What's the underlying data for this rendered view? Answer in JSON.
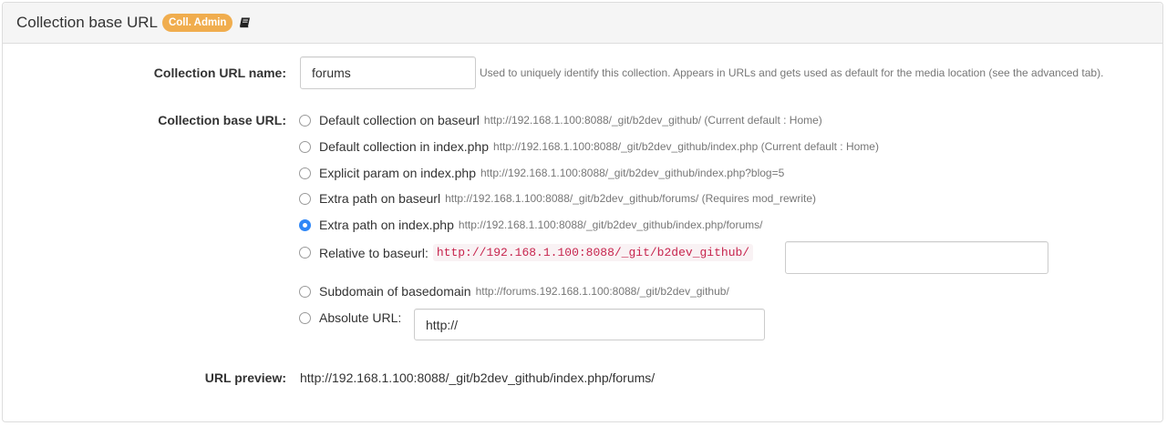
{
  "panel": {
    "title": "Collection base URL",
    "badge": "Coll. Admin",
    "manual_icon": "book-icon"
  },
  "url_name": {
    "label": "Collection URL name:",
    "value": "forums",
    "help": "Used to uniquely identify this collection. Appears in URLs and gets used as default for the media location (see the advanced tab)."
  },
  "base_url": {
    "label": "Collection base URL:",
    "options": [
      {
        "label": "Default collection on baseurl",
        "note": "http://192.168.1.100:8088/_git/b2dev_github/ (Current default : Home)",
        "checked": false
      },
      {
        "label": "Default collection in index.php",
        "note": "http://192.168.1.100:8088/_git/b2dev_github/index.php (Current default : Home)",
        "checked": false
      },
      {
        "label": "Explicit param on index.php",
        "note": "http://192.168.1.100:8088/_git/b2dev_github/index.php?blog=5",
        "checked": false
      },
      {
        "label": "Extra path on baseurl",
        "note": "http://192.168.1.100:8088/_git/b2dev_github/forums/ (Requires mod_rewrite)",
        "checked": false
      },
      {
        "label": "Extra path on index.php",
        "note": "http://192.168.1.100:8088/_git/b2dev_github/index.php/forums/",
        "checked": true
      },
      {
        "label": "Relative to baseurl:",
        "code": "http://192.168.1.100:8088/_git/b2dev_github/",
        "input_value": "",
        "checked": false
      },
      {
        "label": "Subdomain of basedomain",
        "note": "http://forums.192.168.1.100:8088/_git/b2dev_github/",
        "checked": false
      },
      {
        "label": "Absolute URL:",
        "input_value": "http://",
        "checked": false
      }
    ]
  },
  "preview": {
    "label": "URL preview:",
    "value": "http://192.168.1.100:8088/_git/b2dev_github/index.php/forums/"
  },
  "colors": {
    "badge": "#f0ad4e",
    "radio_checked": "#2f87f7",
    "code_text": "#c7254e",
    "code_bg": "#f9f2f4"
  }
}
